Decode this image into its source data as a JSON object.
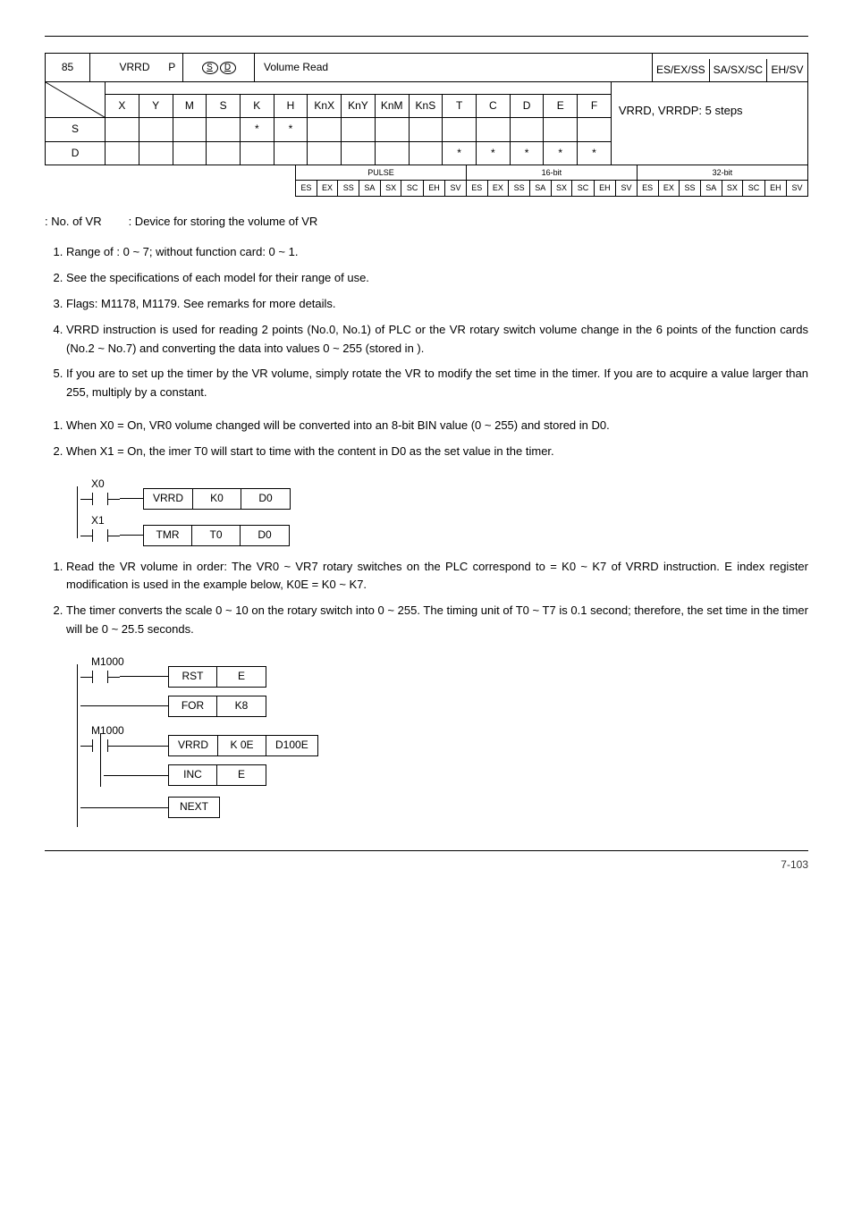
{
  "api": {
    "num": "85",
    "mnemonic": "VRRD",
    "p": "P",
    "function": "Volume Read",
    "controllers_html": [
      "ES/EX/SS",
      "SA/SX/SC",
      "EH/SV"
    ],
    "op_word": "S",
    "op_dest": "D"
  },
  "typerow": {
    "headers": [
      "X",
      "Y",
      "M",
      "S",
      "K",
      "H",
      "KnX",
      "KnY",
      "KnM",
      "KnS",
      "T",
      "C",
      "D",
      "E",
      "F"
    ],
    "stepslabel": "VRRD, VRRDP: 5 steps",
    "rows": [
      {
        "label": "S",
        "marks": {
          "K": "*",
          "H": "*"
        }
      },
      {
        "label": "D",
        "marks": {
          "T": "*",
          "C": "*",
          "D": "*",
          "E": "*",
          "F": "*"
        }
      }
    ]
  },
  "pulse": {
    "pulse_h": "PULSE",
    "b16_h": "16-bit",
    "b32_h": "32-bit",
    "cols": [
      "ES",
      "EX",
      "SS",
      "SA",
      "SX",
      "SC",
      "EH",
      "SV",
      "ES",
      "EX",
      "SS",
      "SA",
      "SX",
      "SC",
      "EH",
      "SV",
      "ES",
      "EX",
      "SS",
      "SA",
      "SX",
      "SC",
      "EH",
      "SV"
    ]
  },
  "defs": {
    "s": ": No. of VR",
    "d": ": Device for storing the volume of VR"
  },
  "explanations": [
    "Range of   : 0 ~ 7; without function card: 0 ~ 1.",
    "See the specifications of each model for their range of use.",
    "Flags: M1178, M1179. See remarks for more details.",
    "VRRD instruction is used for reading 2 points (No.0, No.1) of PLC or the VR rotary switch volume change in the 6 points of the function cards (No.2 ~ No.7) and converting the data into values 0 ~ 255 (stored in   ).",
    "If you are to set up the timer by the VR volume, simply rotate the VR to modify the set time in the timer. If you are to acquire a value larger than 255, multiply   by a constant."
  ],
  "pe1": [
    "When X0 = On, VR0 volume changed will be converted into an 8-bit BIN value (0 ~ 255) and stored in D0.",
    "When X1 = On, the imer T0 will start to time with the content in D0 as the set value in the timer."
  ],
  "ladder1": {
    "r1": {
      "contact": "X0",
      "op": "VRRD",
      "a": "K0",
      "b": "D0"
    },
    "r2": {
      "contact": "X1",
      "op": "TMR",
      "a": "T0",
      "b": "D0"
    }
  },
  "pe2": [
    "Read the VR volume in order: The VR0 ~ VR7 rotary switches on the PLC correspond to   = K0 ~ K7 of VRRD instruction. E index register modification is used in the example below, K0E = K0 ~ K7.",
    "The timer converts the scale 0 ~ 10 on the rotary switch into 0 ~ 255. The timing unit of T0 ~ T7 is 0.1 second; therefore, the set time in the timer will be 0 ~ 25.5 seconds."
  ],
  "ladder2": {
    "c1": "M1000",
    "r1": {
      "op": "RST",
      "a": "E"
    },
    "r2": {
      "op": "FOR",
      "a": "K8"
    },
    "c2": "M1000",
    "r3": {
      "op": "VRRD",
      "a": "K 0E",
      "b": "D100E"
    },
    "r4": {
      "op": "INC",
      "a": "E"
    },
    "r5": {
      "op": "NEXT"
    }
  },
  "footer": "7-103"
}
